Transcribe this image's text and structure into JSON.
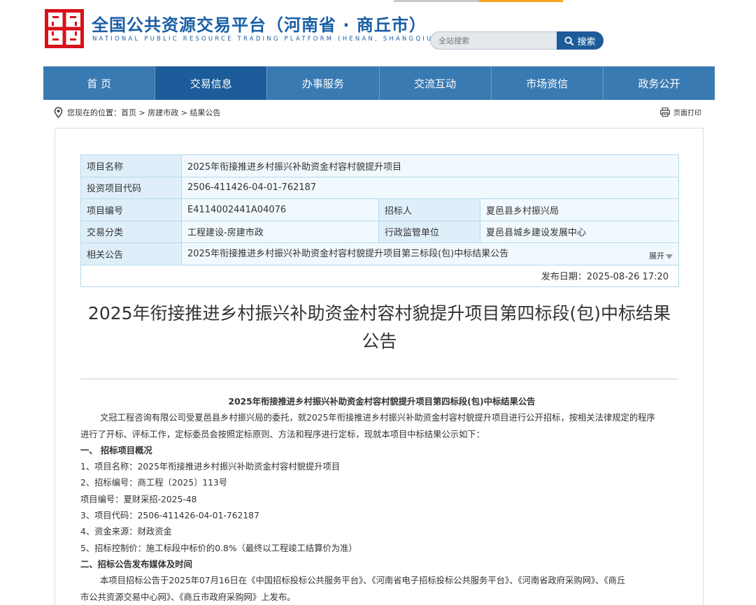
{
  "header": {
    "title": "全国公共资源交易平台（河南省 · 商丘市）",
    "subtitle": "NATIONAL PUBLIC RESOURCE TRADING PLATFORM (HENAN, SHANGQIU)",
    "search_placeholder": "全站搜索",
    "search_button": "搜索"
  },
  "nav": {
    "items": [
      "首 页",
      "交易信息",
      "办事服务",
      "交流互动",
      "市场资信",
      "政务公开"
    ],
    "active": "交易信息"
  },
  "location": {
    "prefix": "您现在的位置：",
    "crumbs": [
      "首页",
      "房建市政",
      "结果公告"
    ],
    "print": "页面打印"
  },
  "info": {
    "project_name_label": "项目名称",
    "project_name": "2025年衔接推进乡村振兴补助资金村容村貌提升项目",
    "invest_code_label": "投资项目代码",
    "invest_code": "2506-411426-04-01-762187",
    "project_no_label": "项目编号",
    "project_no": "E4114002441A04076",
    "tenderer_label": "招标人",
    "tenderer": "夏邑县乡村振兴局",
    "category_label": "交易分类",
    "category": "工程建设-房建市政",
    "supervisor_label": "行政监管单位",
    "supervisor": "夏邑县城乡建设发展中心",
    "related_label": "相关公告",
    "related": "2025年衔接推进乡村振兴补助资金村容村貌提升项目第三标段(包)中标结果公告",
    "expand": "展开",
    "publish_date": "发布日期：2025-08-26 17:20"
  },
  "article": {
    "title": "2025年衔接推进乡村振兴补助资金村容村貌提升项目第四标段(包)中标结果公告",
    "content_title": "2025年衔接推进乡村振兴补助资金村容村貌提升项目第四标段(包)中标结果公告",
    "para1_line1": "文冠工程咨询有限公司受夏邑县乡村振兴局的委托，就2025年衔接推进乡村振兴补助资金村容村貌提升项目进行公开招标，按相关法律规定的程序",
    "para1_line2": "进行了开标、评标工作，定标委员会按照定标原则、方法和程序进行定标，现就本项目中标结果公示如下：",
    "h1": "一、 招标项目概况",
    "l1": "1、项目名称：2025年衔接推进乡村振兴补助资金村容村貌提升项目",
    "l2": "2、招标编号：商工程〔2025〕113号",
    "l3": "项目编号：夏财采招-2025-48",
    "l4": "3、项目代码：2506-411426-04-01-762187",
    "l5": "4、资金来源：财政资金",
    "l6": "5、招标控制价：施工标段中标价的0.8%（最终以工程竣工结算价为准）",
    "h2": "二、招标公告发布媒体及时间",
    "para2_line1": "本项目招标公告于2025年07月16日在《中国招标投标公共服务平台》、《河南省电子招标投标公共服务平台》、《河南省政府采购网》、《商丘",
    "para2_line2": "市公共资源交易中心网》、《商丘市政府采购网》上发布。"
  },
  "colors": {
    "brand_blue": "#1a5fa6",
    "nav_bg": "#3a7ab3",
    "nav_active": "#1d5c9a",
    "logo_red": "#d7121a",
    "table_border": "#b3daea"
  }
}
